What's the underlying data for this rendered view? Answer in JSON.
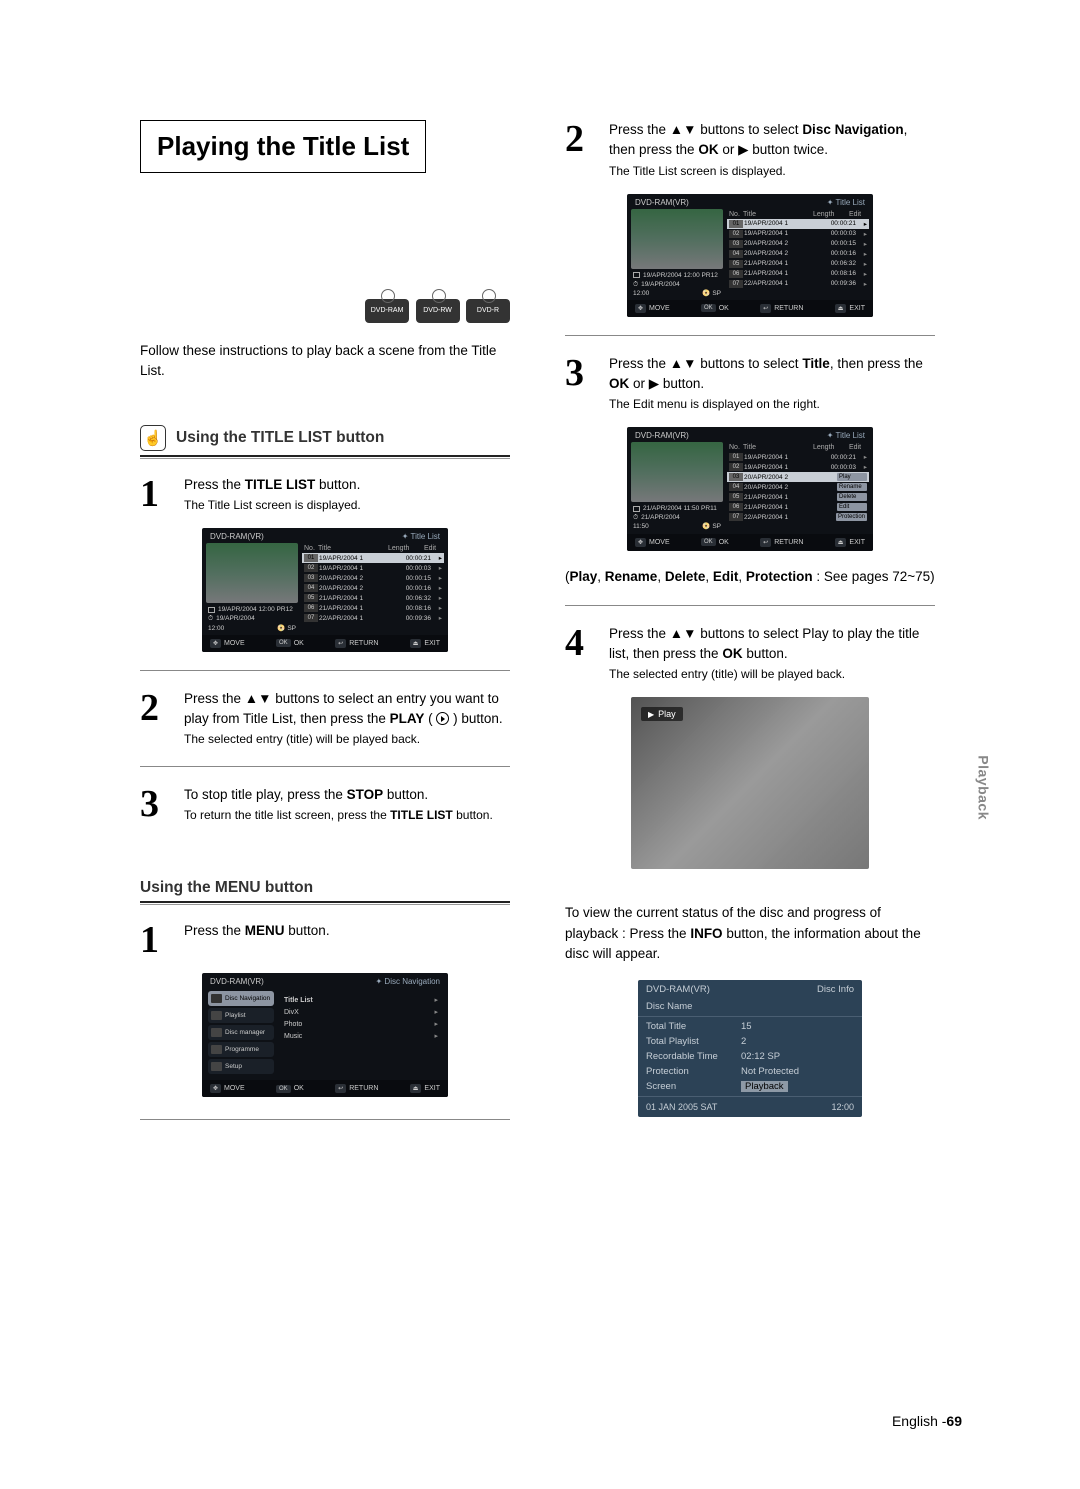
{
  "page_title": "Playing the Title List",
  "disc_labels": [
    "DVD-RAM",
    "DVD-RW",
    "DVD-R"
  ],
  "intro": "Follow these instructions to play back a scene from the Title List.",
  "side_tab": "Playback",
  "page_footer_lang": "English -",
  "page_footer_num": "69",
  "sectionA_title": "Using the TITLE LIST button",
  "sectionB_title": "Using the MENU button",
  "left": {
    "s1_main_a": "Press the ",
    "s1_main_b": "TITLE LIST",
    "s1_main_c": " button.",
    "s1_sub": "The Title List screen is displayed.",
    "s2_main": "Press the ▲▼ buttons to select an entry you want to play from Title List, then press the ",
    "s2_play": "PLAY",
    "s2_tail": " (       ) button.",
    "s2_sub": "The selected entry (title) will be played back.",
    "s3_main_a": "To stop title play, press the ",
    "s3_main_b": "STOP",
    "s3_main_c": " button.",
    "s3_sub_a": "To return the title list screen, press the ",
    "s3_sub_b": "TITLE LIST",
    "s3_sub_c": " button."
  },
  "menu": {
    "s1_main_a": "Press the ",
    "s1_main_b": "MENU",
    "s1_main_c": " button."
  },
  "right": {
    "s2_main_a": "Press the ▲▼ buttons to select ",
    "s2_main_b": "Disc Navigation",
    "s2_main_c": ", then press the ",
    "s2_main_d": "OK",
    "s2_main_e": " or ▶ button twice.",
    "s2_sub": "The Title List screen is displayed.",
    "s3_main_a": "Press the ▲▼ buttons to select ",
    "s3_main_b": "Title",
    "s3_main_c": ", then press the ",
    "s3_main_d": "OK",
    "s3_main_e": " or ▶ button.",
    "s3_sub": "The Edit menu is displayed on the right.",
    "s3_note_a": "(",
    "s3_note_b": "Play",
    "s3_note_c": ", ",
    "s3_note_d": "Rename",
    "s3_note_e": ", ",
    "s3_note_f": "Delete",
    "s3_note_g": ", ",
    "s3_note_h": "Edit",
    "s3_note_i": ", ",
    "s3_note_j": "Protection",
    "s3_note_k": " : See pages 72~75)",
    "s4_main_a": "Press the ▲▼ buttons to select Play to play the title list, then press the ",
    "s4_main_b": "OK",
    "s4_main_c": " button.",
    "s4_sub": "The selected entry (title) will be played back.",
    "footnote": "To view the current status of the disc and progress of playback : Press the ",
    "footnote_b": "INFO",
    "footnote_c": " button, the information about the disc will appear."
  },
  "play_label": "Play",
  "osd_title": {
    "mode": "DVD-RAM(VR)",
    "header": "Title List",
    "cols": [
      "No.",
      "Title",
      "Length",
      "Edit"
    ],
    "meta_line1": "19/APR/2004 12:00 PR12",
    "meta_line2": "19/APR/2004",
    "meta_line3_time": "12:00",
    "meta_line3_mode": "SP",
    "rows": [
      {
        "no": "01",
        "t": "19/APR/2004 1",
        "len": "00:00:21"
      },
      {
        "no": "02",
        "t": "19/APR/2004 1",
        "len": "00:00:03"
      },
      {
        "no": "03",
        "t": "20/APR/2004 2",
        "len": "00:00:15"
      },
      {
        "no": "04",
        "t": "20/APR/2004 2",
        "len": "00:00:16"
      },
      {
        "no": "05",
        "t": "21/APR/2004 1",
        "len": "00:06:32"
      },
      {
        "no": "06",
        "t": "21/APR/2004 1",
        "len": "00:08:16"
      },
      {
        "no": "07",
        "t": "22/APR/2004 1",
        "len": "00:09:36"
      }
    ],
    "foot": [
      "MOVE",
      "OK",
      "RETURN",
      "EXIT"
    ]
  },
  "osd_title2": {
    "meta_line1": "21/APR/2004 11:50 PR11",
    "meta_line2": "21/APR/2004",
    "meta_line3_time": "11:50",
    "rows": [
      {
        "no": "01",
        "t": "19/APR/2004 1",
        "len": "00:00:21"
      },
      {
        "no": "02",
        "t": "19/APR/2004 1",
        "len": "00:00:03"
      },
      {
        "no": "03",
        "t": "20/APR/2004 2",
        "edit": "Play"
      },
      {
        "no": "04",
        "t": "20/APR/2004 2",
        "edit": "Rename"
      },
      {
        "no": "05",
        "t": "21/APR/2004 1",
        "edit": "Delete"
      },
      {
        "no": "06",
        "t": "21/APR/2004 1",
        "edit": "Edit"
      },
      {
        "no": "07",
        "t": "22/APR/2004 1",
        "edit": "Protection"
      }
    ]
  },
  "osd_menu": {
    "mode": "DVD-RAM(VR)",
    "header": "Disc Navigation",
    "side": [
      "Disc Navigation",
      "Playlist",
      "Disc manager",
      "Programme",
      "Setup"
    ],
    "sub": [
      "Title List",
      "DivX",
      "Photo",
      "Music"
    ],
    "foot": [
      "MOVE",
      "OK",
      "RETURN",
      "EXIT"
    ]
  },
  "discinfo": {
    "mode": "DVD-RAM(VR)",
    "header": "Disc Info",
    "rows": [
      {
        "k": "Disc Name",
        "v": ""
      },
      {
        "k": "Total Title",
        "v": "15"
      },
      {
        "k": "Total Playlist",
        "v": "2"
      },
      {
        "k": "Recordable Time",
        "v": "02:12  SP"
      },
      {
        "k": "Protection",
        "v": "Not Protected"
      },
      {
        "k": "Screen",
        "v": "Playback"
      }
    ],
    "date": "01 JAN 2005 SAT",
    "time": "12:00"
  }
}
